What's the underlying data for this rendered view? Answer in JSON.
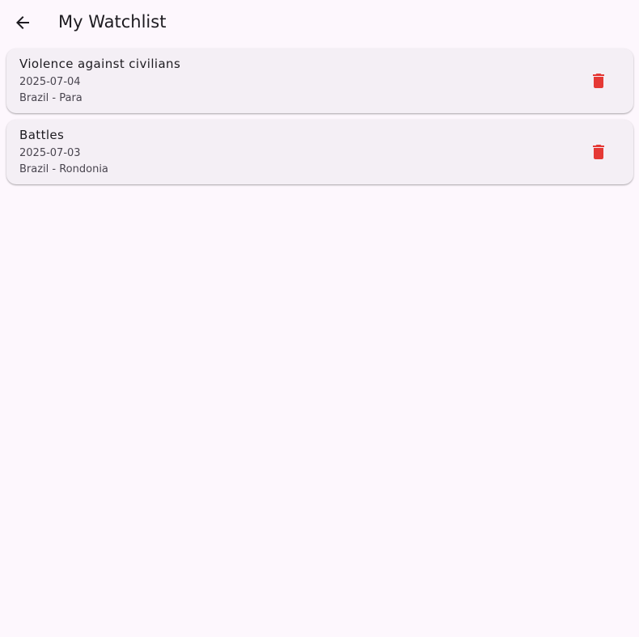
{
  "header": {
    "title": "My Watchlist",
    "back_icon": "arrow-back-icon"
  },
  "theme": {
    "background": "#fdf7fd",
    "card_background": "#f4eff5",
    "delete_color": "#e53935",
    "text_primary": "#1d1b20",
    "text_secondary": "#49454f"
  },
  "items": [
    {
      "title": "Violence against civilians",
      "date": "2025-07-04",
      "location": "Brazil - Para",
      "action_icon": "delete-icon"
    },
    {
      "title": "Battles",
      "date": "2025-07-03",
      "location": "Brazil - Rondonia",
      "action_icon": "delete-icon"
    }
  ]
}
